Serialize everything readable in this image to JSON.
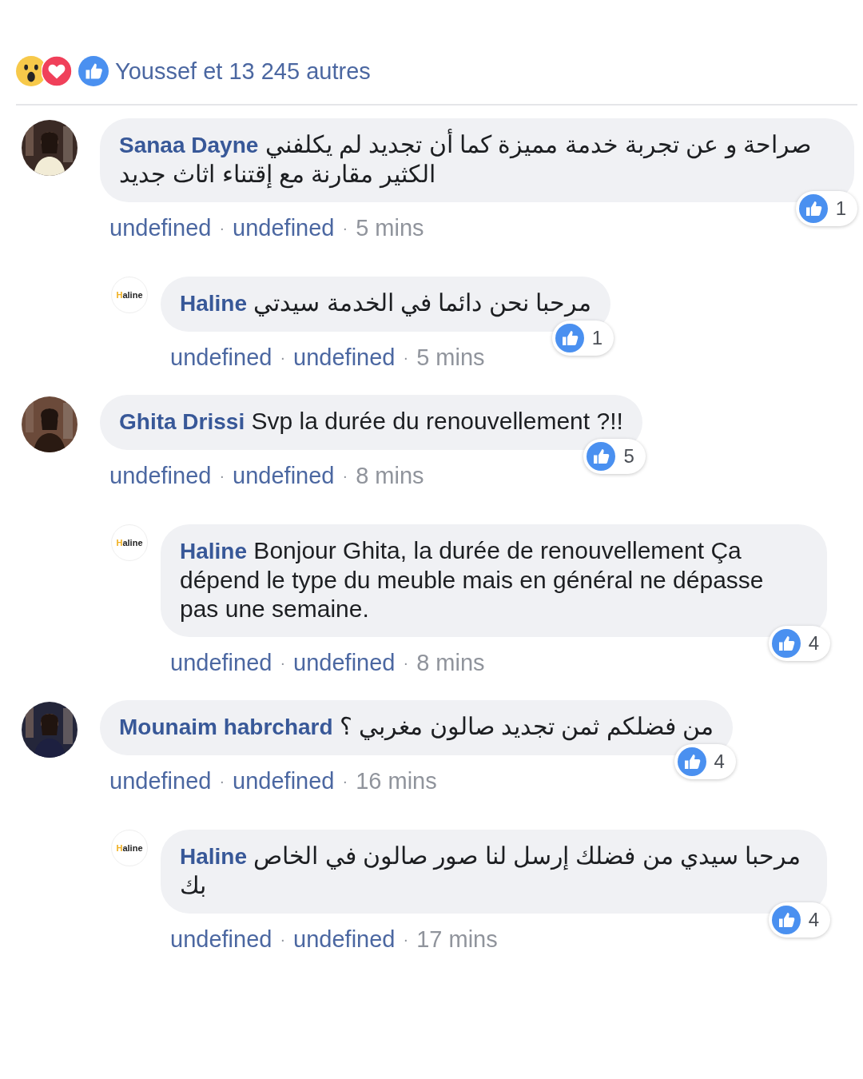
{
  "reactions": {
    "icons": [
      {
        "kind": "wow"
      },
      {
        "kind": "love"
      },
      {
        "kind": "like"
      }
    ],
    "summary": "Youssef et 13 245 autres"
  },
  "comments": [
    {
      "author": "Sanaa Dayne",
      "text": "صراحة و عن تجربة خدمة مميزة كما أن تجديد لم يكلفني الكثير مقارنة مع إقتناء اثاث جديد",
      "likes": "1",
      "meta": [
        {
          "kind": "action",
          "text": "undefined"
        },
        {
          "kind": "separator",
          "text": "·"
        },
        {
          "kind": "action",
          "text": "undefined"
        },
        {
          "kind": "separator",
          "text": "·"
        },
        {
          "kind": "time",
          "text": "5 mins"
        }
      ],
      "replies": [
        {
          "author": "Haline",
          "text": "مرحبا نحن دائما في الخدمة سيدتي",
          "likes": "1",
          "avatar": {
            "kind": "logo",
            "text": "Haline"
          },
          "meta": [
            {
              "kind": "action",
              "text": "undefined"
            },
            {
              "kind": "separator",
              "text": "·"
            },
            {
              "kind": "action",
              "text": "undefined"
            },
            {
              "kind": "separator",
              "text": "·"
            },
            {
              "kind": "time",
              "text": "5 mins"
            }
          ]
        }
      ]
    },
    {
      "author": "Ghita Drissi",
      "text": "Svp la durée du renouvellement ?!!",
      "likes": "5",
      "meta": [
        {
          "kind": "action",
          "text": "undefined"
        },
        {
          "kind": "separator",
          "text": "·"
        },
        {
          "kind": "action",
          "text": "undefined"
        },
        {
          "kind": "separator",
          "text": "·"
        },
        {
          "kind": "time",
          "text": "8 mins"
        }
      ],
      "replies": [
        {
          "author": "Haline",
          "text": "Bonjour Ghita, la durée de renouvellement Ça dépend le type du meuble mais en général ne dépasse pas une semaine.",
          "likes": "4",
          "avatar": {
            "kind": "logo",
            "text": "Haline"
          },
          "meta": [
            {
              "kind": "action",
              "text": "undefined"
            },
            {
              "kind": "separator",
              "text": "·"
            },
            {
              "kind": "action",
              "text": "undefined"
            },
            {
              "kind": "separator",
              "text": "·"
            },
            {
              "kind": "time",
              "text": "8 mins"
            }
          ]
        }
      ]
    },
    {
      "author": "Mounaim habrchard",
      "text": "من فضلكم ثمن تجديد صالون مغربي ؟",
      "likes": "4",
      "meta": [
        {
          "kind": "action",
          "text": "undefined"
        },
        {
          "kind": "separator",
          "text": "·"
        },
        {
          "kind": "action",
          "text": "undefined"
        },
        {
          "kind": "separator",
          "text": "·"
        },
        {
          "kind": "time",
          "text": "16 mins"
        }
      ],
      "replies": [
        {
          "author": "Haline",
          "text": "مرحبا سيدي من فضلك إرسل لنا صور صالون في الخاص بك",
          "likes": "4",
          "avatar": {
            "kind": "logo",
            "text": "Haline"
          },
          "meta": [
            {
              "kind": "action",
              "text": "undefined"
            },
            {
              "kind": "separator",
              "text": "·"
            },
            {
              "kind": "action",
              "text": "undefined"
            },
            {
              "kind": "separator",
              "text": "·"
            },
            {
              "kind": "time",
              "text": "17 mins"
            }
          ]
        }
      ]
    }
  ]
}
